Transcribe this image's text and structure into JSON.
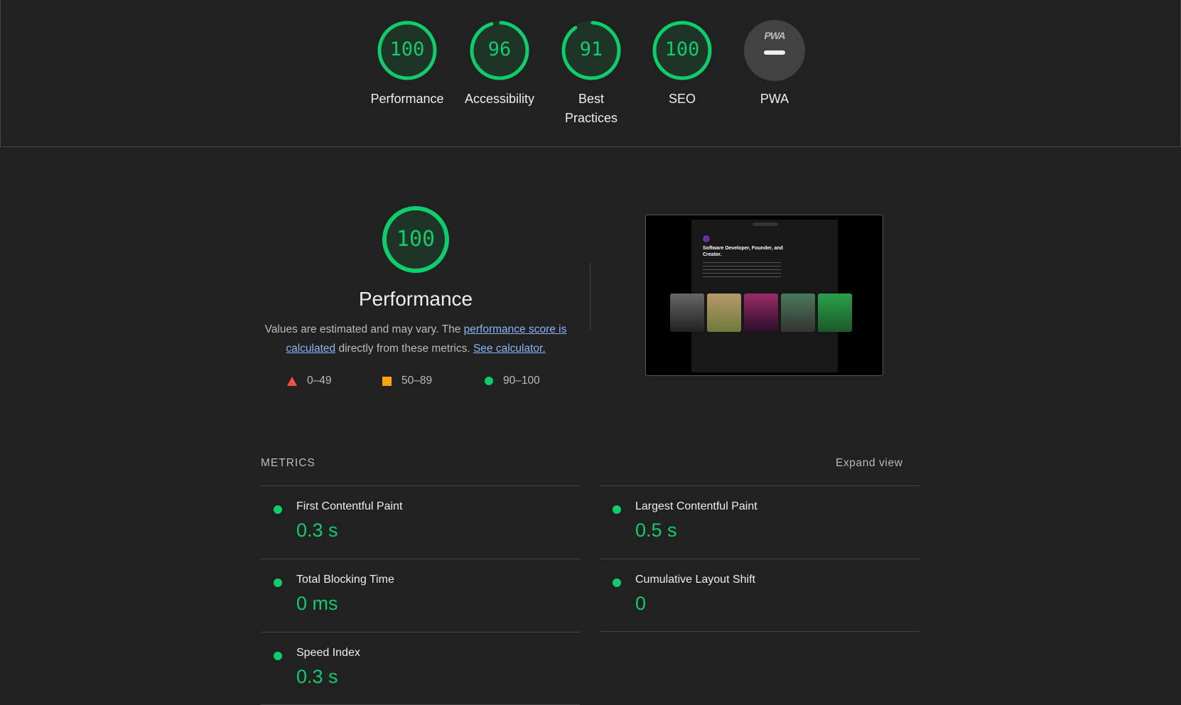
{
  "colors": {
    "pass": "#0cce6b",
    "average": "#ffa400",
    "fail": "#ff4e42",
    "background": "#212121",
    "link": "#8ab4f8"
  },
  "categories": [
    {
      "label": "Performance",
      "score": 100
    },
    {
      "label": "Accessibility",
      "score": 96
    },
    {
      "label": "Best Practices",
      "score": 91
    },
    {
      "label": "SEO",
      "score": 100
    },
    {
      "label": "PWA",
      "score": null,
      "badge": "PWA"
    }
  ],
  "performance": {
    "score": 100,
    "title": "Performance",
    "desc_prefix": "Values are estimated and may vary. The ",
    "desc_link1": "performance score is calculated",
    "desc_middle": " directly from these metrics. ",
    "desc_link2": "See calculator.",
    "legend": [
      {
        "icon": "triangle-icon",
        "range": "0–49"
      },
      {
        "icon": "square-icon",
        "range": "50–89"
      },
      {
        "icon": "circle-icon",
        "range": "90–100"
      }
    ],
    "screenshot": {
      "heading": "Software Developer, Founder, and Creator."
    }
  },
  "metrics": {
    "header": "METRICS",
    "expand": "Expand view",
    "items": [
      {
        "label": "First Contentful Paint",
        "value": "0.3 s"
      },
      {
        "label": "Largest Contentful Paint",
        "value": "0.5 s"
      },
      {
        "label": "Total Blocking Time",
        "value": "0 ms"
      },
      {
        "label": "Cumulative Layout Shift",
        "value": "0"
      },
      {
        "label": "Speed Index",
        "value": "0.3 s"
      }
    ]
  }
}
